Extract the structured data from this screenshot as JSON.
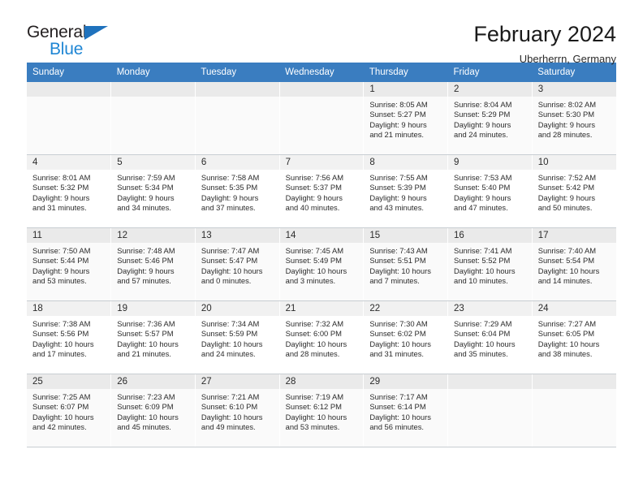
{
  "brand": {
    "word_one": "General",
    "word_two": "Blue",
    "triangle_icon": "triangle-icon",
    "accent_color": "#1f86d4"
  },
  "header": {
    "title": "February 2024",
    "subtitle": "Uberherrn, Germany"
  },
  "theme": {
    "header_row_bg": "#3a7dc0",
    "daynum_bg": "#f1f1f1",
    "shaded_row_bg": "#fafafa",
    "grid_line": "#c8cdd2"
  },
  "calendar": {
    "weekday_headers": [
      "Sunday",
      "Monday",
      "Tuesday",
      "Wednesday",
      "Thursday",
      "Friday",
      "Saturday"
    ],
    "labels": {
      "sunrise": "Sunrise:",
      "sunset": "Sunset:",
      "daylight": "Daylight:"
    },
    "weeks": [
      [
        {
          "day": "",
          "empty": true
        },
        {
          "day": "",
          "empty": true
        },
        {
          "day": "",
          "empty": true
        },
        {
          "day": "",
          "empty": true
        },
        {
          "day": "1",
          "sunrise": "Sunrise: 8:05 AM",
          "sunset": "Sunset: 5:27 PM",
          "daylight_line1": "Daylight: 9 hours",
          "daylight_line2": "and 21 minutes."
        },
        {
          "day": "2",
          "sunrise": "Sunrise: 8:04 AM",
          "sunset": "Sunset: 5:29 PM",
          "daylight_line1": "Daylight: 9 hours",
          "daylight_line2": "and 24 minutes."
        },
        {
          "day": "3",
          "sunrise": "Sunrise: 8:02 AM",
          "sunset": "Sunset: 5:30 PM",
          "daylight_line1": "Daylight: 9 hours",
          "daylight_line2": "and 28 minutes."
        }
      ],
      [
        {
          "day": "4",
          "sunrise": "Sunrise: 8:01 AM",
          "sunset": "Sunset: 5:32 PM",
          "daylight_line1": "Daylight: 9 hours",
          "daylight_line2": "and 31 minutes."
        },
        {
          "day": "5",
          "sunrise": "Sunrise: 7:59 AM",
          "sunset": "Sunset: 5:34 PM",
          "daylight_line1": "Daylight: 9 hours",
          "daylight_line2": "and 34 minutes."
        },
        {
          "day": "6",
          "sunrise": "Sunrise: 7:58 AM",
          "sunset": "Sunset: 5:35 PM",
          "daylight_line1": "Daylight: 9 hours",
          "daylight_line2": "and 37 minutes."
        },
        {
          "day": "7",
          "sunrise": "Sunrise: 7:56 AM",
          "sunset": "Sunset: 5:37 PM",
          "daylight_line1": "Daylight: 9 hours",
          "daylight_line2": "and 40 minutes."
        },
        {
          "day": "8",
          "sunrise": "Sunrise: 7:55 AM",
          "sunset": "Sunset: 5:39 PM",
          "daylight_line1": "Daylight: 9 hours",
          "daylight_line2": "and 43 minutes."
        },
        {
          "day": "9",
          "sunrise": "Sunrise: 7:53 AM",
          "sunset": "Sunset: 5:40 PM",
          "daylight_line1": "Daylight: 9 hours",
          "daylight_line2": "and 47 minutes."
        },
        {
          "day": "10",
          "sunrise": "Sunrise: 7:52 AM",
          "sunset": "Sunset: 5:42 PM",
          "daylight_line1": "Daylight: 9 hours",
          "daylight_line2": "and 50 minutes."
        }
      ],
      [
        {
          "day": "11",
          "sunrise": "Sunrise: 7:50 AM",
          "sunset": "Sunset: 5:44 PM",
          "daylight_line1": "Daylight: 9 hours",
          "daylight_line2": "and 53 minutes."
        },
        {
          "day": "12",
          "sunrise": "Sunrise: 7:48 AM",
          "sunset": "Sunset: 5:46 PM",
          "daylight_line1": "Daylight: 9 hours",
          "daylight_line2": "and 57 minutes."
        },
        {
          "day": "13",
          "sunrise": "Sunrise: 7:47 AM",
          "sunset": "Sunset: 5:47 PM",
          "daylight_line1": "Daylight: 10 hours",
          "daylight_line2": "and 0 minutes."
        },
        {
          "day": "14",
          "sunrise": "Sunrise: 7:45 AM",
          "sunset": "Sunset: 5:49 PM",
          "daylight_line1": "Daylight: 10 hours",
          "daylight_line2": "and 3 minutes."
        },
        {
          "day": "15",
          "sunrise": "Sunrise: 7:43 AM",
          "sunset": "Sunset: 5:51 PM",
          "daylight_line1": "Daylight: 10 hours",
          "daylight_line2": "and 7 minutes."
        },
        {
          "day": "16",
          "sunrise": "Sunrise: 7:41 AM",
          "sunset": "Sunset: 5:52 PM",
          "daylight_line1": "Daylight: 10 hours",
          "daylight_line2": "and 10 minutes."
        },
        {
          "day": "17",
          "sunrise": "Sunrise: 7:40 AM",
          "sunset": "Sunset: 5:54 PM",
          "daylight_line1": "Daylight: 10 hours",
          "daylight_line2": "and 14 minutes."
        }
      ],
      [
        {
          "day": "18",
          "sunrise": "Sunrise: 7:38 AM",
          "sunset": "Sunset: 5:56 PM",
          "daylight_line1": "Daylight: 10 hours",
          "daylight_line2": "and 17 minutes."
        },
        {
          "day": "19",
          "sunrise": "Sunrise: 7:36 AM",
          "sunset": "Sunset: 5:57 PM",
          "daylight_line1": "Daylight: 10 hours",
          "daylight_line2": "and 21 minutes."
        },
        {
          "day": "20",
          "sunrise": "Sunrise: 7:34 AM",
          "sunset": "Sunset: 5:59 PM",
          "daylight_line1": "Daylight: 10 hours",
          "daylight_line2": "and 24 minutes."
        },
        {
          "day": "21",
          "sunrise": "Sunrise: 7:32 AM",
          "sunset": "Sunset: 6:00 PM",
          "daylight_line1": "Daylight: 10 hours",
          "daylight_line2": "and 28 minutes."
        },
        {
          "day": "22",
          "sunrise": "Sunrise: 7:30 AM",
          "sunset": "Sunset: 6:02 PM",
          "daylight_line1": "Daylight: 10 hours",
          "daylight_line2": "and 31 minutes."
        },
        {
          "day": "23",
          "sunrise": "Sunrise: 7:29 AM",
          "sunset": "Sunset: 6:04 PM",
          "daylight_line1": "Daylight: 10 hours",
          "daylight_line2": "and 35 minutes."
        },
        {
          "day": "24",
          "sunrise": "Sunrise: 7:27 AM",
          "sunset": "Sunset: 6:05 PM",
          "daylight_line1": "Daylight: 10 hours",
          "daylight_line2": "and 38 minutes."
        }
      ],
      [
        {
          "day": "25",
          "sunrise": "Sunrise: 7:25 AM",
          "sunset": "Sunset: 6:07 PM",
          "daylight_line1": "Daylight: 10 hours",
          "daylight_line2": "and 42 minutes."
        },
        {
          "day": "26",
          "sunrise": "Sunrise: 7:23 AM",
          "sunset": "Sunset: 6:09 PM",
          "daylight_line1": "Daylight: 10 hours",
          "daylight_line2": "and 45 minutes."
        },
        {
          "day": "27",
          "sunrise": "Sunrise: 7:21 AM",
          "sunset": "Sunset: 6:10 PM",
          "daylight_line1": "Daylight: 10 hours",
          "daylight_line2": "and 49 minutes."
        },
        {
          "day": "28",
          "sunrise": "Sunrise: 7:19 AM",
          "sunset": "Sunset: 6:12 PM",
          "daylight_line1": "Daylight: 10 hours",
          "daylight_line2": "and 53 minutes."
        },
        {
          "day": "29",
          "sunrise": "Sunrise: 7:17 AM",
          "sunset": "Sunset: 6:14 PM",
          "daylight_line1": "Daylight: 10 hours",
          "daylight_line2": "and 56 minutes."
        },
        {
          "day": "",
          "empty": true
        },
        {
          "day": "",
          "empty": true
        }
      ]
    ]
  }
}
